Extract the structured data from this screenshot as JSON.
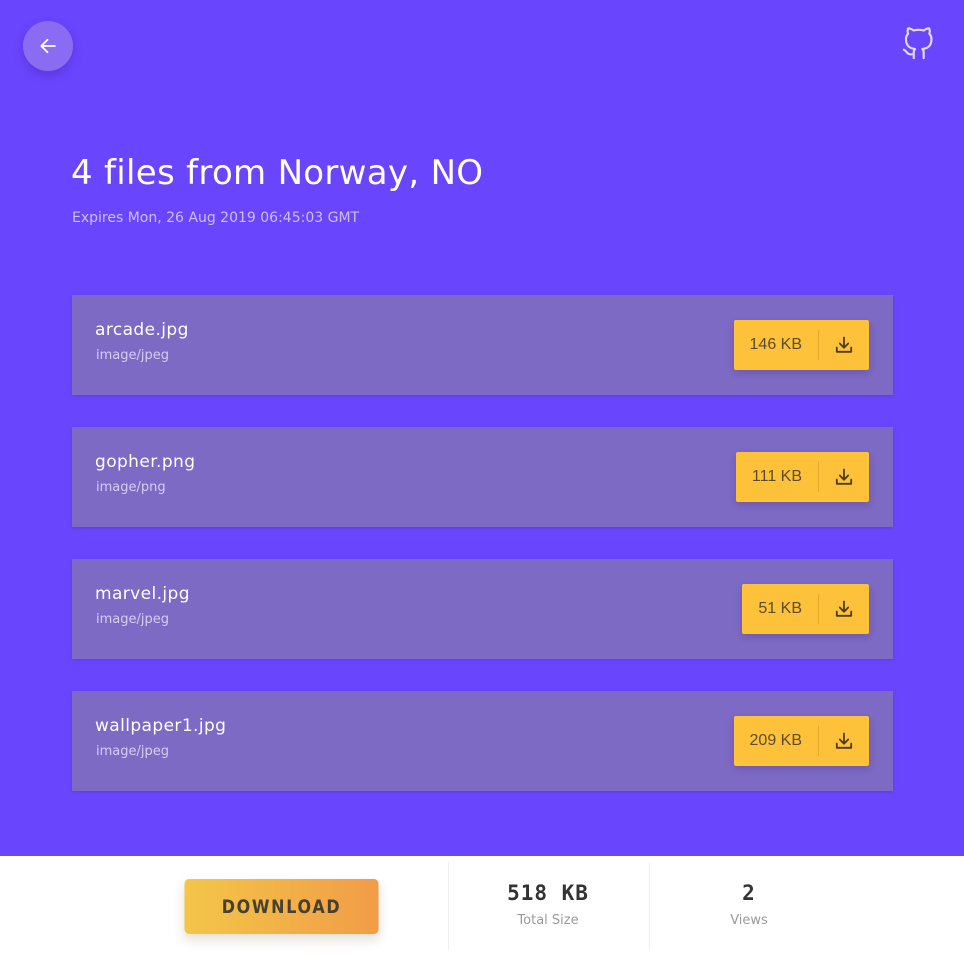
{
  "header": {
    "back_icon": "arrow-left-icon",
    "github_icon": "github-icon"
  },
  "page": {
    "title": "4 files from Norway, NO",
    "expires": "Expires Mon, 26 Aug 2019 06:45:03 GMT"
  },
  "files": [
    {
      "name": "arcade.jpg",
      "type": "image/jpeg",
      "size": "146 KB"
    },
    {
      "name": "gopher.png",
      "type": "image/png",
      "size": "111 KB"
    },
    {
      "name": "marvel.jpg",
      "type": "image/jpeg",
      "size": "51 KB"
    },
    {
      "name": "wallpaper1.jpg",
      "type": "image/jpeg",
      "size": "209 KB"
    }
  ],
  "file_download_icon": "download-icon",
  "footer": {
    "download_label": "DOWNLOAD",
    "total_size_value": "518 KB",
    "total_size_label": "Total Size",
    "views_value": "2",
    "views_label": "Views"
  },
  "colors": {
    "background": "#6a45fe",
    "card": "#7d6ac4",
    "accent": "#fec13a",
    "button_gradient_start": "#f3c649",
    "button_gradient_end": "#f29c47"
  }
}
